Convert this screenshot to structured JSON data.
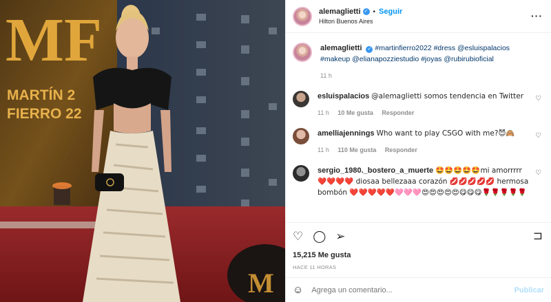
{
  "post": {
    "username": "alemaglietti",
    "follow_label": "Seguir",
    "location": "Hilton Buenos Aires",
    "backdrop_text": {
      "logo": "MF",
      "line1": "MARTÍN 2",
      "line2": "FIERRO 22"
    }
  },
  "caption": {
    "username": "alemaglietti",
    "text": "#martinfierro2022 #dress @esluispalacios #makeup @elianapozziestudio #joyas @rubirubioficial",
    "time": "11 h"
  },
  "comments": [
    {
      "username": "esluispalacios",
      "text": "@alemaglietti somos tendencia en Twitter",
      "time": "11 h",
      "likes": "10 Me gusta",
      "reply": "Responder"
    },
    {
      "username": "amelliajennings",
      "text": "Who want to play CSGO with me?😈🙈",
      "time": "11 h",
      "likes": "110 Me gusta",
      "reply": "Responder"
    },
    {
      "username": "sergio_1980._bostero_a_muerte",
      "text": "🤩🤩🤩🤩🤩mi amorrrrr ❤️❤️❤️❤️ diosaa bellezaaa corazón 💋💋💋💋💋 hermosa bombón ❤️❤️❤️❤️❤️🩷🩷🩷😍😍😍😍😍😋😋😋🌹🌹🌹🌹🌹",
      "time": "",
      "likes": "",
      "reply": ""
    }
  ],
  "actions": {
    "like": "heart-outline-icon",
    "comment": "comment-icon",
    "share": "paper-plane-icon",
    "save": "bookmark-icon"
  },
  "likes_label": "15,215 Me gusta",
  "timestamp": "HACE 11 HORAS",
  "add_comment": {
    "placeholder": "Agrega un comentario...",
    "post_label": "Publicar"
  },
  "colors": {
    "accent": "#0095f6",
    "link": "#00376b",
    "muted": "#8e8e8e",
    "carpet": "#8b1f22",
    "backdrop": "#1d2c3c",
    "gold": "#d9a441"
  }
}
